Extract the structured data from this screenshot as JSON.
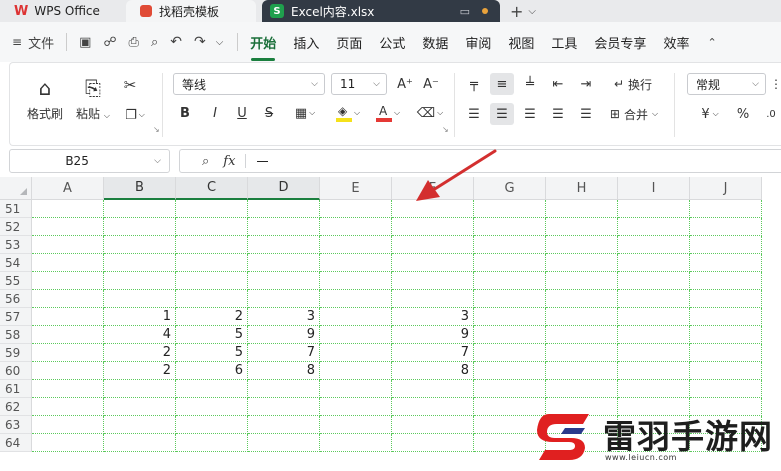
{
  "titlebar": {
    "tabs": [
      {
        "label": "WPS Office",
        "logo": "W"
      },
      {
        "label": "找稻壳模板"
      },
      {
        "label": "Excel内容.xlsx",
        "logo": "S"
      }
    ]
  },
  "menubar": {
    "file_label": "文件",
    "tabs": [
      "开始",
      "插入",
      "页面",
      "公式",
      "数据",
      "审阅",
      "视图",
      "工具",
      "会员专享",
      "效率"
    ],
    "active_tab": "开始"
  },
  "ribbon": {
    "format_painter": "格式刷",
    "paste": "粘贴",
    "font_name": "等线",
    "font_size": "11",
    "wrap_text": "换行",
    "merge": "合并",
    "number_format": "常规",
    "currency_symbol": "¥",
    "percent_symbol": "%",
    "font_color_accent": "#e53935",
    "fill_color_accent": "#f5e11b"
  },
  "formula_bar": {
    "cell_ref": "B25",
    "fx_label": "fx",
    "content": "一"
  },
  "grid": {
    "columns": [
      "A",
      "B",
      "C",
      "D",
      "E",
      "F",
      "G",
      "H",
      "I",
      "J"
    ],
    "selected_columns": [
      "B",
      "C",
      "D"
    ],
    "rows": [
      {
        "num": "51",
        "cells": {}
      },
      {
        "num": "52",
        "cells": {}
      },
      {
        "num": "53",
        "cells": {}
      },
      {
        "num": "54",
        "cells": {}
      },
      {
        "num": "55",
        "cells": {}
      },
      {
        "num": "56",
        "cells": {}
      },
      {
        "num": "57",
        "cells": {
          "B": "1",
          "C": "2",
          "D": "3",
          "F": "3"
        }
      },
      {
        "num": "58",
        "cells": {
          "B": "4",
          "C": "5",
          "D": "9",
          "F": "9"
        }
      },
      {
        "num": "59",
        "cells": {
          "B": "2",
          "C": "5",
          "D": "7",
          "F": "7"
        }
      },
      {
        "num": "60",
        "cells": {
          "B": "2",
          "C": "6",
          "D": "8",
          "F": "8"
        }
      },
      {
        "num": "61",
        "cells": {}
      },
      {
        "num": "62",
        "cells": {}
      },
      {
        "num": "63",
        "cells": {}
      },
      {
        "num": "64",
        "cells": {}
      }
    ],
    "gridline_color": "#5cc95c"
  },
  "annotation": {
    "arrow_color": "#d32f2f"
  },
  "watermark": {
    "title": "雷羽手游网",
    "url": "www.leiucn.com"
  }
}
